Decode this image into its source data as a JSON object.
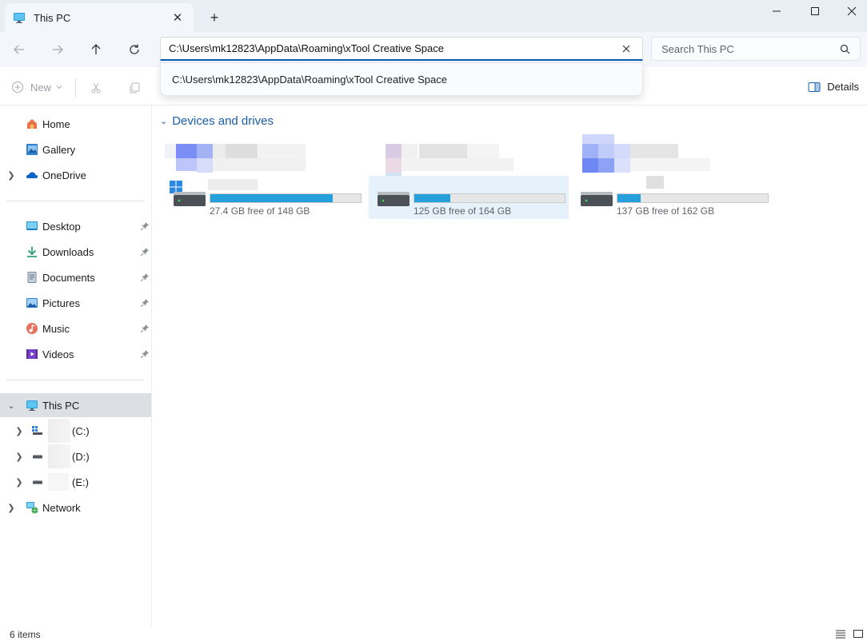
{
  "window": {
    "tab_title": "This PC",
    "close_tab_glyph": "✕",
    "new_tab_glyph": "+"
  },
  "address_bar": {
    "value": "C:\\Users\\mk12823\\AppData\\Roaming\\xTool Creative Space",
    "suggestion": "C:\\Users\\mk12823\\AppData\\Roaming\\xTool Creative Space"
  },
  "search": {
    "placeholder": "Search This PC"
  },
  "command_bar": {
    "new_label": "New",
    "details_label": "Details"
  },
  "sidebar": {
    "quick": [
      {
        "label": "Home",
        "icon": "home-icon"
      },
      {
        "label": "Gallery",
        "icon": "gallery-icon"
      },
      {
        "label": "OneDrive",
        "icon": "onedrive-icon"
      }
    ],
    "pinned": [
      {
        "label": "Desktop",
        "icon": "desktop-icon"
      },
      {
        "label": "Downloads",
        "icon": "downloads-icon"
      },
      {
        "label": "Documents",
        "icon": "documents-icon"
      },
      {
        "label": "Pictures",
        "icon": "pictures-icon"
      },
      {
        "label": "Music",
        "icon": "music-icon"
      },
      {
        "label": "Videos",
        "icon": "videos-icon"
      }
    ],
    "this_pc": "This PC",
    "drives": [
      {
        "label": "(C:)"
      },
      {
        "label": "(D:)"
      },
      {
        "label": "(E:)"
      }
    ],
    "network": "Network"
  },
  "content": {
    "group_title": "Devices and drives",
    "drives": [
      {
        "free_text": "27.4 GB free of 148 GB",
        "used_fraction": 0.815,
        "selected": false
      },
      {
        "free_text": "125 GB free of 164 GB",
        "used_fraction": 0.238,
        "selected": true
      },
      {
        "free_text": "137 GB free of 162 GB",
        "used_fraction": 0.154,
        "selected": false
      }
    ]
  },
  "status_bar": {
    "items_count": "6 items"
  },
  "colors": {
    "accent": "#0b5cad",
    "drive_bar": "#26a0da",
    "group_title": "#1a5fa8"
  }
}
